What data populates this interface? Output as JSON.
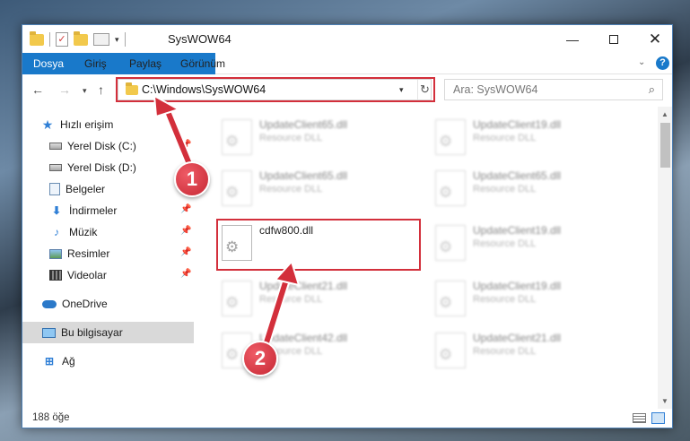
{
  "window": {
    "title": "SysWOW64",
    "controls": {
      "minimize": "—",
      "close": "✕"
    }
  },
  "ribbon": {
    "tabs": [
      {
        "label": "Dosya"
      },
      {
        "label": "Giriş"
      },
      {
        "label": "Paylaş"
      },
      {
        "label": "Görünüm"
      }
    ],
    "help": "?"
  },
  "navigation": {
    "address": "C:\\Windows\\SysWOW64",
    "search_placeholder": "Ara: SysWOW64"
  },
  "sidebar": {
    "items": [
      {
        "label": "Hızlı erişim",
        "icon": "star-icon"
      },
      {
        "label": "Yerel Disk (C:)",
        "icon": "drive-icon",
        "pinned": true
      },
      {
        "label": "Yerel Disk (D:)",
        "icon": "drive-icon"
      },
      {
        "label": "Belgeler",
        "icon": "documents-icon"
      },
      {
        "label": "İndirmeler",
        "icon": "downloads-icon",
        "pinned": true
      },
      {
        "label": "Müzik",
        "icon": "music-icon",
        "pinned": true
      },
      {
        "label": "Resimler",
        "icon": "pictures-icon",
        "pinned": true
      },
      {
        "label": "Videolar",
        "icon": "videos-icon",
        "pinned": true
      },
      {
        "label": "OneDrive",
        "icon": "onedrive-icon"
      },
      {
        "label": "Bu bilgisayar",
        "icon": "this-pc-icon",
        "selected": true
      },
      {
        "label": "Ağ",
        "icon": "network-icon"
      }
    ]
  },
  "files": [
    {
      "name": "UpdateClient65.dll",
      "desc": "Resource DLL"
    },
    {
      "name": "UpdateClient19.dll",
      "desc": "Resource DLL"
    },
    {
      "name": "UpdateClient65.dll",
      "desc": "Resource DLL"
    },
    {
      "name": "UpdateClient65.dll",
      "desc": "Resource DLL"
    },
    {
      "name": "cdfw800.dll",
      "desc": ""
    },
    {
      "name": "UpdateClient19.dll",
      "desc": "Resource DLL"
    },
    {
      "name": "UpdateClient21.dll",
      "desc": "Resource DLL"
    },
    {
      "name": "UpdateClient19.dll",
      "desc": "Resource DLL"
    },
    {
      "name": "UpdateClient42.dll",
      "desc": "Resource DLL"
    },
    {
      "name": "UpdateClient21.dll",
      "desc": "Resource DLL"
    }
  ],
  "status": {
    "count": "188 öğe"
  },
  "annotations": {
    "step1": "1",
    "step2": "2",
    "color": "#d32f3b"
  }
}
